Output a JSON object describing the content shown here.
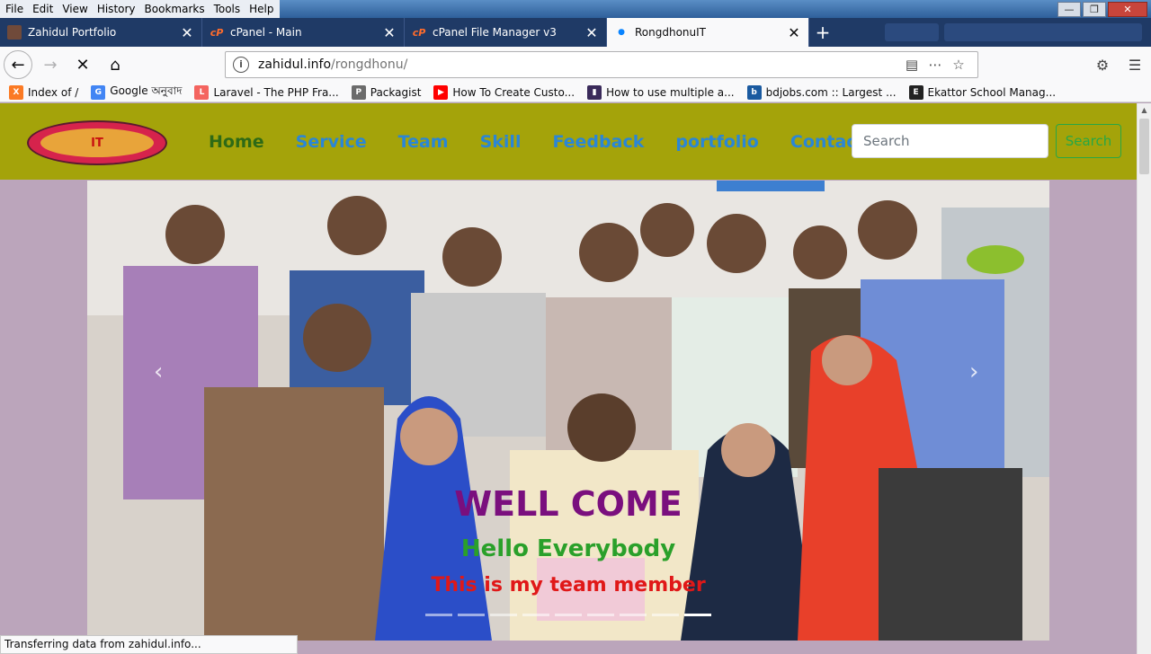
{
  "menubar": {
    "items": [
      "File",
      "Edit",
      "View",
      "History",
      "Bookmarks",
      "Tools",
      "Help"
    ]
  },
  "tabs": [
    {
      "title": "Zahidul Portfolio",
      "icon": "portfolio-favicon",
      "active": false
    },
    {
      "title": "cPanel - Main",
      "icon": "cpanel-favicon",
      "active": false
    },
    {
      "title": "cPanel File Manager v3",
      "icon": "cpanel-favicon",
      "active": false
    },
    {
      "title": "RongdhonuIT",
      "icon": "loading-dot-icon",
      "active": true
    }
  ],
  "navbar": {
    "url_host": "zahidul.info",
    "url_path": "/rongdhonu/"
  },
  "bookmarks": [
    {
      "label": "Index of /",
      "icon": "xampp-icon",
      "color": "#fb7a24"
    },
    {
      "label": "Google অনুবাদ",
      "icon": "google-translate-icon",
      "color": "#4285f4"
    },
    {
      "label": "Laravel - The PHP Fra...",
      "icon": "laravel-icon",
      "color": "#f4645f"
    },
    {
      "label": "Packagist",
      "icon": "packagist-icon",
      "color": "#6b6b6b"
    },
    {
      "label": "How To Create Custo...",
      "icon": "youtube-icon",
      "color": "#ff0000"
    },
    {
      "label": "How to use multiple a...",
      "icon": "bookmark-icon",
      "color": "#3a2a5a"
    },
    {
      "label": "bdjobs.com :: Largest ...",
      "icon": "bdjobs-icon",
      "color": "#1a5aa0"
    },
    {
      "label": "Ekattor School Manag...",
      "icon": "ekattor-icon",
      "color": "#222222"
    }
  ],
  "site": {
    "logo_text": "IT",
    "nav": [
      "Home",
      "Service",
      "Team",
      "Skill",
      "Feedback",
      "portfolio",
      "Contact"
    ],
    "search_placeholder": "Search",
    "search_button": "Search",
    "carousel": {
      "title": "WELL COME",
      "subtitle": "Hello Everybody",
      "tagline": "This is my team member",
      "slide_count": 9,
      "active_slide": 9
    }
  },
  "status_text": "Transferring data from zahidul.info...",
  "colors": {
    "header_bg": "#a4a30a",
    "nav_link": "#2a86d6",
    "nav_active": "#2e6a16",
    "page_bg": "#bba5bb",
    "title_color": "#7a0f7e",
    "subtitle_color": "#2aa02a",
    "tagline_color": "#e01818"
  }
}
